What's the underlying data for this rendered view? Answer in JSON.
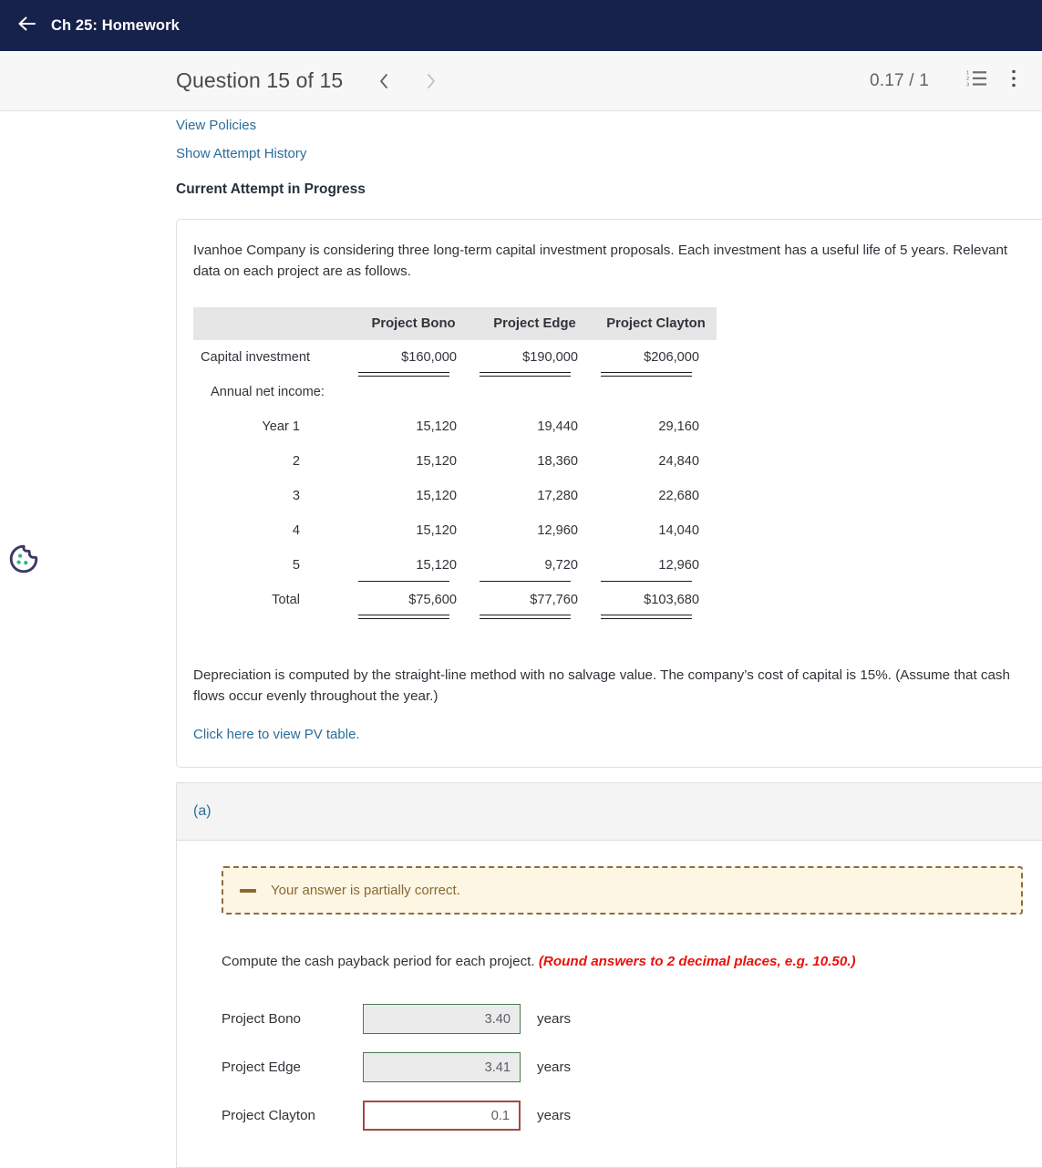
{
  "appbar": {
    "back_icon": "arrow-left-icon",
    "title": "Ch 25: Homework",
    "background": "#16214c"
  },
  "question_bar": {
    "title": "Question 15 of 15",
    "prev_icon": "chevron-left-icon",
    "next_icon": "chevron-right-icon",
    "score": "0.17 / 1",
    "list_icon": "numbered-list-icon",
    "menu_icon": "kebab-menu-icon"
  },
  "top_links": {
    "view_policies": "View Policies",
    "show_attempt_history": "Show Attempt History"
  },
  "attempt_heading": "Current Attempt in Progress",
  "question": {
    "intro": "Ivanhoe Company is considering three long-term capital investment proposals. Each investment has a useful life of 5 years. Relevant data on each project are as follows.",
    "note": "Depreciation is computed by the straight-line method with no salvage value. The company’s cost of capital is 15%. (Assume that cash flows occur evenly throughout the year.)",
    "pv_link": "Click here to view PV table."
  },
  "data_table": {
    "headers": [
      "",
      "Project Bono",
      "Project Edge",
      "Project Clayton"
    ],
    "capital_investment": {
      "label": "Capital investment",
      "values": [
        "$160,000",
        "$190,000",
        "$206,000"
      ]
    },
    "annual_net_income_label": "Annual net income:",
    "years": [
      {
        "label": "Year  1",
        "values": [
          "15,120",
          "19,440",
          "29,160"
        ]
      },
      {
        "label": "2",
        "values": [
          "15,120",
          "18,360",
          "24,840"
        ]
      },
      {
        "label": "3",
        "values": [
          "15,120",
          "17,280",
          "22,680"
        ]
      },
      {
        "label": "4",
        "values": [
          "15,120",
          "12,960",
          "14,040"
        ]
      },
      {
        "label": "5",
        "values": [
          "15,120",
          "9,720",
          "12,960"
        ]
      }
    ],
    "total": {
      "label": "Total",
      "values": [
        "$75,600",
        "$77,760",
        "$103,680"
      ]
    }
  },
  "part_a": {
    "letter": "(a)",
    "alert": {
      "icon": "minus-icon",
      "text": "Your answer is partially correct.",
      "border_color": "#8b6d3f",
      "background": "#fdf6e3"
    },
    "prompt": "Compute the cash payback period for each project.",
    "prompt_emphasis": "(Round answers to 2 decimal places, e.g. 10.50.)",
    "prompt_emphasis_color": "#e8120c",
    "rows": [
      {
        "label": "Project Bono",
        "value": "3.40",
        "unit": "years",
        "state": "ok"
      },
      {
        "label": "Project Edge",
        "value": "3.41",
        "unit": "years",
        "state": "ok"
      },
      {
        "label": "Project Clayton",
        "value": "0.1",
        "unit": "years",
        "state": "bad"
      }
    ]
  },
  "cookie_widget": {
    "icon": "cookie-icon"
  }
}
